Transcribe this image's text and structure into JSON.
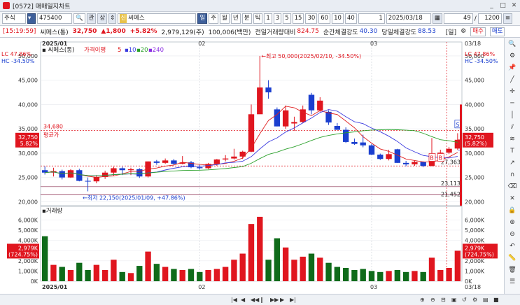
{
  "window": {
    "title": "[0572] 매매일지차트",
    "minimize": "_",
    "maximize": "□",
    "close": "✕"
  },
  "toolbar": {
    "market": "주식",
    "code": "475400",
    "btn_gwan": "관",
    "btn_sang": "상",
    "name_prefix": "신",
    "stock_name": "씨메스",
    "periods": [
      "일",
      "주",
      "월",
      "년",
      "분",
      "틱"
    ],
    "active_period": "일",
    "intervals": [
      "1",
      "3",
      "5",
      "15",
      "30",
      "60",
      "10",
      "40"
    ],
    "count": "1",
    "date": "2025/03/18",
    "display_count": "49",
    "slash": "/",
    "total_count": "1200"
  },
  "quote": {
    "time": "[15:19:59]",
    "name": "씨메스(통)",
    "price": "32,750",
    "change": "▲1,800",
    "change_pct": "+5.82%",
    "volume": "2,979,129(주)",
    "amount": "100,006(백만)",
    "prev_vol_label": "전일거래량대비",
    "prev_vol_value": "824.75",
    "strength_label": "순간체결강도",
    "strength_value": "40.30",
    "day_strength_label": "당일체결강도",
    "day_strength_value": "88.53",
    "period_badge": "[일]",
    "buy": "매수",
    "sell": "매도"
  },
  "price_chart": {
    "legend_name": "씨메스(통)",
    "legend_ma": "가격이평",
    "ma_periods": [
      "5",
      "10",
      "20",
      "240"
    ],
    "ma_colors": [
      "#e02020",
      "#3a3adf",
      "#2aa02a",
      "#8a2be2"
    ],
    "left_lc": "LC 47.86%",
    "left_hc": "HC -34.50%",
    "right_lc": "LC 47.86%",
    "right_hc": "HC -34.50%",
    "x_labels": [
      "2025/01",
      "02",
      "03"
    ],
    "right_top_date": "03/18",
    "y_ticks": [
      "50,000",
      "45,000",
      "40,000",
      "35,000",
      "30,000",
      "25,000",
      "20,000"
    ],
    "ylim": [
      19200,
      52000
    ],
    "high_note": "←최고 50,000(2025/02/10, -34.50%)",
    "low_note": "←최저 22,150(2025/01/09, +47.86%)",
    "avg_price": "34,680",
    "avg_label": "평균가",
    "level_27363": "27,363",
    "level_23113": "23,113",
    "level_21452": "21,452",
    "left_price_box": "32,750",
    "left_pct_box": "5.82%",
    "right_price_box": "32,750",
    "right_pct_box": "(5.82%)",
    "marker_s": "S",
    "marker_b": "B"
  },
  "volume_chart": {
    "legend": "거래량",
    "y_ticks": [
      "6,000K",
      "5,000K",
      "4,000K",
      "3,000K",
      "2,000K",
      "1,000K",
      "0K"
    ],
    "ymax": 6500,
    "left_box": "2,979K",
    "left_box2": "(724.75%)",
    "right_box": "2,979K",
    "right_box2": "(724.75%)",
    "x_labels": [
      "2025/01",
      "02",
      "03"
    ],
    "bottom_right_date": "03/18"
  },
  "chart_data": {
    "type": "candlestick",
    "candles": [
      {
        "o": 26500,
        "h": 27300,
        "l": 25600,
        "c": 26000,
        "v": 4400
      },
      {
        "o": 26000,
        "h": 27000,
        "l": 25200,
        "c": 26300,
        "v": 1600
      },
      {
        "o": 26300,
        "h": 26600,
        "l": 24600,
        "c": 25000,
        "v": 1400
      },
      {
        "o": 25000,
        "h": 26700,
        "l": 24900,
        "c": 26500,
        "v": 1100
      },
      {
        "o": 26500,
        "h": 26800,
        "l": 24200,
        "c": 24300,
        "v": 1800
      },
      {
        "o": 24300,
        "h": 25000,
        "l": 22150,
        "c": 24200,
        "v": 1100
      },
      {
        "o": 24200,
        "h": 25500,
        "l": 23800,
        "c": 25100,
        "v": 1600
      },
      {
        "o": 25100,
        "h": 26400,
        "l": 24700,
        "c": 26000,
        "v": 1100
      },
      {
        "o": 26000,
        "h": 27200,
        "l": 25300,
        "c": 26900,
        "v": 2100
      },
      {
        "o": 26900,
        "h": 27200,
        "l": 25500,
        "c": 26500,
        "v": 900
      },
      {
        "o": 26500,
        "h": 27000,
        "l": 25500,
        "c": 26700,
        "v": 800
      },
      {
        "o": 26700,
        "h": 26900,
        "l": 24900,
        "c": 25200,
        "v": 1500
      },
      {
        "o": 25200,
        "h": 28300,
        "l": 25000,
        "c": 28300,
        "v": 2900
      },
      {
        "o": 28300,
        "h": 28600,
        "l": 27600,
        "c": 28000,
        "v": 1700
      },
      {
        "o": 28000,
        "h": 28900,
        "l": 27800,
        "c": 28500,
        "v": 1400
      },
      {
        "o": 28500,
        "h": 28800,
        "l": 27500,
        "c": 27800,
        "v": 1200
      },
      {
        "o": 27800,
        "h": 29400,
        "l": 27700,
        "c": 28100,
        "v": 1100
      },
      {
        "o": 28100,
        "h": 28400,
        "l": 26900,
        "c": 27100,
        "v": 1200
      },
      {
        "o": 27100,
        "h": 27600,
        "l": 26600,
        "c": 26900,
        "v": 900
      },
      {
        "o": 26900,
        "h": 28000,
        "l": 26700,
        "c": 27800,
        "v": 1100
      },
      {
        "o": 27800,
        "h": 28800,
        "l": 27400,
        "c": 28700,
        "v": 1200
      },
      {
        "o": 28700,
        "h": 29600,
        "l": 28300,
        "c": 28900,
        "v": 1400
      },
      {
        "o": 28900,
        "h": 30900,
        "l": 28700,
        "c": 29300,
        "v": 2100
      },
      {
        "o": 29300,
        "h": 30500,
        "l": 28800,
        "c": 30300,
        "v": 2700
      },
      {
        "o": 30300,
        "h": 40000,
        "l": 30200,
        "c": 38000,
        "v": 5600
      },
      {
        "o": 38000,
        "h": 50000,
        "l": 41500,
        "c": 43500,
        "v": 6300
      },
      {
        "o": 43500,
        "h": 45000,
        "l": 41200,
        "c": 42500,
        "v": 2100
      },
      {
        "o": 39000,
        "h": 39400,
        "l": 35500,
        "c": 35500,
        "v": 4200
      },
      {
        "o": 35500,
        "h": 39800,
        "l": 35000,
        "c": 38800,
        "v": 3300
      },
      {
        "o": 36100,
        "h": 37500,
        "l": 34600,
        "c": 36400,
        "v": 2100
      },
      {
        "o": 36400,
        "h": 39800,
        "l": 36200,
        "c": 39000,
        "v": 2400
      },
      {
        "o": 42000,
        "h": 42400,
        "l": 38000,
        "c": 38800,
        "v": 2700
      },
      {
        "o": 38800,
        "h": 41500,
        "l": 38500,
        "c": 40800,
        "v": 2300
      },
      {
        "o": 38500,
        "h": 38800,
        "l": 35800,
        "c": 36300,
        "v": 1800
      },
      {
        "o": 35600,
        "h": 36200,
        "l": 34800,
        "c": 34800,
        "v": 1400
      },
      {
        "o": 34800,
        "h": 35300,
        "l": 32100,
        "c": 32300,
        "v": 1300
      },
      {
        "o": 32300,
        "h": 33000,
        "l": 31700,
        "c": 31900,
        "v": 1100
      },
      {
        "o": 32200,
        "h": 33800,
        "l": 31200,
        "c": 31600,
        "v": 1200
      },
      {
        "o": 31600,
        "h": 31900,
        "l": 29600,
        "c": 29700,
        "v": 1000
      },
      {
        "o": 29700,
        "h": 29900,
        "l": 28600,
        "c": 28800,
        "v": 900
      },
      {
        "o": 28800,
        "h": 30700,
        "l": 28500,
        "c": 29800,
        "v": 1000
      },
      {
        "o": 30800,
        "h": 30900,
        "l": 28000,
        "c": 28000,
        "v": 1100
      },
      {
        "o": 28000,
        "h": 28400,
        "l": 27300,
        "c": 27700,
        "v": 900
      },
      {
        "o": 27700,
        "h": 28500,
        "l": 27400,
        "c": 28200,
        "v": 1000
      },
      {
        "o": 28200,
        "h": 28300,
        "l": 27100,
        "c": 27363,
        "v": 900
      },
      {
        "o": 27363,
        "h": 33100,
        "l": 27300,
        "c": 29600,
        "v": 2300
      },
      {
        "o": 29600,
        "h": 30700,
        "l": 29100,
        "c": 30100,
        "v": 1100
      },
      {
        "o": 30100,
        "h": 31300,
        "l": 29800,
        "c": 30900,
        "v": 1300
      },
      {
        "o": 30950,
        "h": 34100,
        "l": 30700,
        "c": 32750,
        "v": 2979
      }
    ]
  },
  "rightbar_icons": [
    "magnifier-icon",
    "settings-icon",
    "pin-icon",
    "line-tool-icon",
    "cross-tool-icon",
    "h-line-tool-icon",
    "v-line-tool-icon",
    "channel-tool-icon",
    "fibo-tool-icon",
    "text-tool-icon",
    "arrow-tool-icon",
    "magnet-icon",
    "eraser-icon",
    "x-icon",
    "lock-icon",
    "zoom-in-icon",
    "zoom-out-icon",
    "undo-icon",
    "ruler-icon",
    "trash-icon",
    "list-icon"
  ],
  "bottombar": {
    "nav": [
      "|◀",
      "◀",
      "◀◀",
      "‖",
      "▶▶",
      "▶",
      "▶|"
    ],
    "tools": [
      "⊕",
      "⊖",
      "⊟",
      "▣",
      "↺",
      "⚙",
      "▤",
      "■"
    ]
  }
}
